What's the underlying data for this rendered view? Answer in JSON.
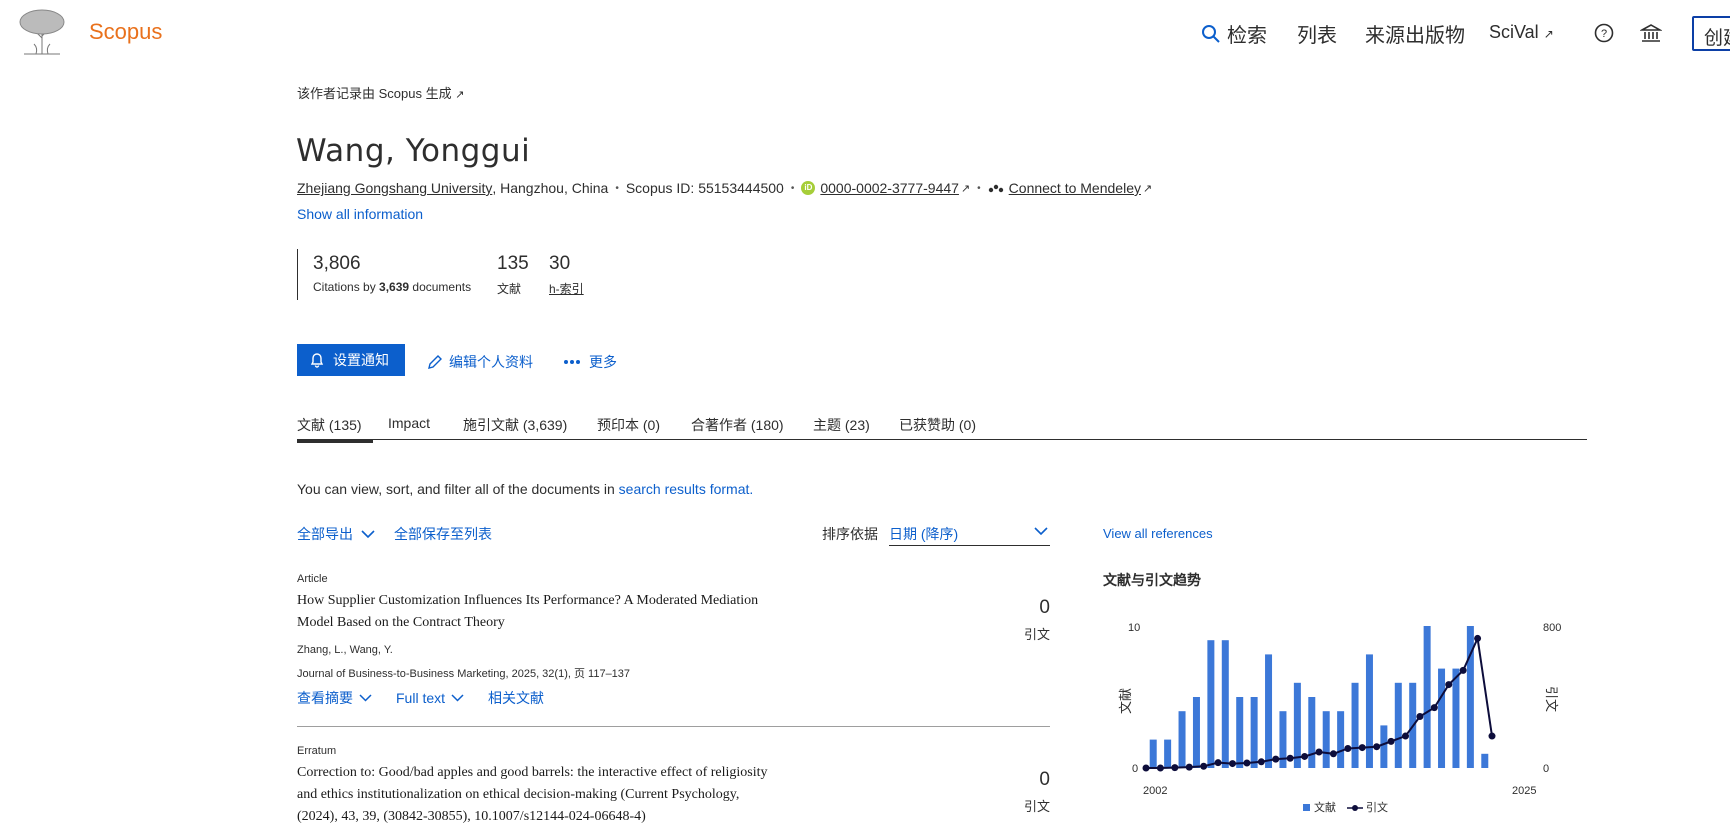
{
  "header": {
    "brand": "Scopus",
    "nav": {
      "search": "检索",
      "lists": "列表",
      "sources": "来源出版物",
      "scival": "SciVal"
    },
    "create_label": "创建"
  },
  "profile": {
    "generated_note": "该作者记录由 Scopus 生成",
    "name": "Wang, Yonggui",
    "affiliation": "Zhejiang Gongshang University",
    "location": ", Hangzhou, China",
    "scopus_id": "Scopus ID: 55153444500",
    "orcid": "0000-0002-3777-9447",
    "mendeley": "Connect to Mendeley",
    "show_all": "Show all information"
  },
  "metrics": {
    "citations": "3,806",
    "citations_label_pre": "Citations by ",
    "citations_docs": "3,639",
    "citations_label_post": " documents",
    "documents": "135",
    "documents_label": "文献",
    "h_index": "30",
    "h_index_label": "h-索引"
  },
  "actions": {
    "alert": "设置通知",
    "edit": "编辑个人资料",
    "more": "更多"
  },
  "tabs": [
    {
      "label": "文献 (135)"
    },
    {
      "label": "Impact"
    },
    {
      "label": "施引文献 (3,639)"
    },
    {
      "label": "预印本 (0)"
    },
    {
      "label": "合著作者 (180)"
    },
    {
      "label": "主题 (23)"
    },
    {
      "label": "已获赞助 (0)"
    }
  ],
  "list": {
    "note_pre": "You can view, sort, and filter all of the documents in ",
    "note_link": "search results format.",
    "export_all": "全部导出",
    "save_all": "全部保存至列表",
    "sort_label": "排序依据",
    "sort_value": "日期 (降序)"
  },
  "documents": [
    {
      "type": "Article",
      "title": "How Supplier Customization Influences Its Performance? A Moderated Mediation Model Based on the Contract Theory",
      "authors": "Zhang, L., Wang, Y.",
      "source": "Journal of Business-to-Business Marketing, 2025, 32(1), 页 117–137",
      "citations": "0",
      "citations_label": "引文",
      "abstract_label": "查看摘要",
      "fulltext_label": "Full text",
      "related_label": "相关文献"
    },
    {
      "type": "Erratum",
      "title": "Correction to: Good/bad apples and good barrels: the interactive effect of religiosity and ethics institutionalization on ethical decision-making (Current Psychology, (2024), 43, 39, (30842-30855), 10.1007/s12144-024-06648-4)",
      "citations": "0",
      "citations_label": "引文"
    }
  ],
  "sidebar": {
    "view_refs": "View all references",
    "chart_title": "文献与引文趋势"
  },
  "chart_data": {
    "type": "bar",
    "x_start_label": "2002",
    "x_end_label": "2025",
    "years": [
      2002,
      2003,
      2004,
      2005,
      2006,
      2007,
      2008,
      2009,
      2010,
      2011,
      2012,
      2013,
      2014,
      2015,
      2016,
      2017,
      2018,
      2019,
      2020,
      2021,
      2022,
      2023,
      2024,
      2025
    ],
    "series": [
      {
        "name": "文献",
        "type": "bar",
        "color": "#3c78d8",
        "values": [
          2,
          2,
          4,
          5,
          9,
          9,
          5,
          5,
          8,
          4,
          6,
          5,
          4,
          4,
          6,
          8,
          3,
          6,
          6,
          10,
          7,
          7,
          10,
          1
        ]
      },
      {
        "name": "引文",
        "type": "line",
        "color": "#0d0d3b",
        "values": [
          0,
          0,
          2,
          5,
          10,
          30,
          25,
          28,
          35,
          50,
          55,
          65,
          90,
          80,
          110,
          115,
          120,
          150,
          180,
          290,
          340,
          470,
          550,
          730,
          180
        ]
      }
    ],
    "y_left": {
      "label": "文献",
      "min_label": "0",
      "max_label": "10",
      "range": [
        0,
        10
      ]
    },
    "y_right": {
      "label": "引文",
      "min_label": "0",
      "max_label": "800",
      "range": [
        0,
        800
      ]
    },
    "legend": [
      "文献",
      "引文"
    ]
  }
}
